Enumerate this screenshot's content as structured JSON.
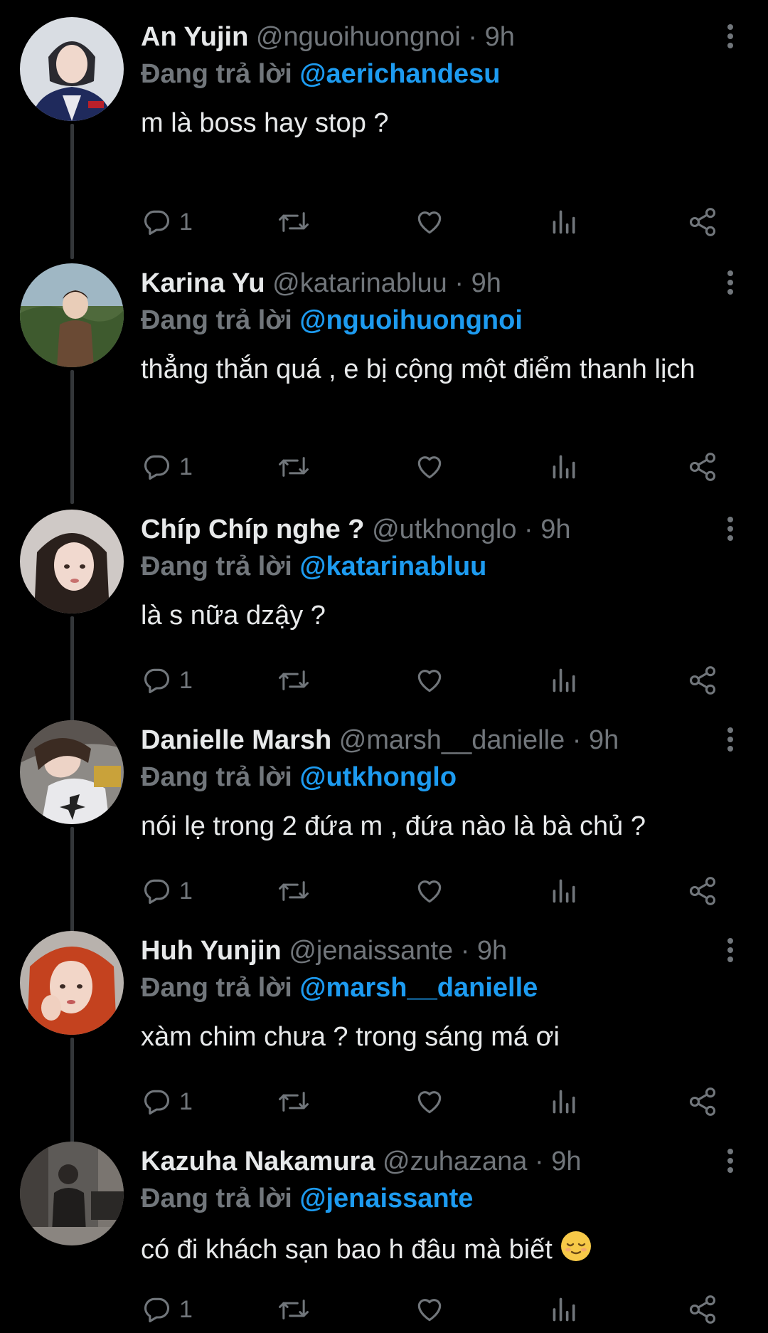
{
  "theme": {
    "background": "#000000",
    "text": "#e7e9ea",
    "muted": "#71767b",
    "link": "#1d9bf0",
    "thread_line": "#333639"
  },
  "tweets": [
    {
      "display_name": "An Yujin",
      "handle": "@nguoihuongnoi",
      "dot": "·",
      "time": "9h",
      "reply_prefix": "Đang trả lời",
      "reply_to": "@aerichandesu",
      "text": "m là boss hay stop ?",
      "reply_count": "1",
      "icons": [
        "reply-icon",
        "retweet-icon",
        "like-icon",
        "views-icon",
        "share-icon"
      ]
    },
    {
      "display_name": "Karina Yu",
      "handle": "@katarinabluu",
      "dot": "·",
      "time": "9h",
      "reply_prefix": "Đang trả lời",
      "reply_to": "@nguoihuongnoi",
      "text": "thẳng thắn quá , e bị cộng một điểm thanh lịch",
      "reply_count": "1"
    },
    {
      "display_name": "Chíp Chíp nghe ?",
      "handle": "@utkhonglo",
      "dot": "·",
      "time": "9h",
      "reply_prefix": "Đang trả lời",
      "reply_to": "@katarinabluu",
      "text": "là s nữa dzậy ?",
      "reply_count": "1"
    },
    {
      "display_name": "Danielle Marsh",
      "handle": "@marsh__danielle",
      "dot": "·",
      "time": "9h",
      "reply_prefix": "Đang trả lời",
      "reply_to": "@utkhonglo",
      "text": "nói lẹ trong 2 đứa m , đứa nào là bà chủ ?",
      "reply_count": "1"
    },
    {
      "display_name": "Huh Yunjin",
      "handle": "@jenaissante",
      "dot": "·",
      "time": "9h",
      "reply_prefix": "Đang trả lời",
      "reply_to": "@marsh__danielle",
      "text": "xàm chim chưa ? trong sáng má ơi",
      "reply_count": "1"
    },
    {
      "display_name": "Kazuha Nakamura",
      "handle": "@zuhazana",
      "dot": "·",
      "time": "9h",
      "reply_prefix": "Đang trả lời",
      "reply_to": "@jenaissante",
      "text": "có đi khách sạn bao h đâu mà biết",
      "emoji": "relieved-face-emoji",
      "reply_count": "1"
    }
  ]
}
